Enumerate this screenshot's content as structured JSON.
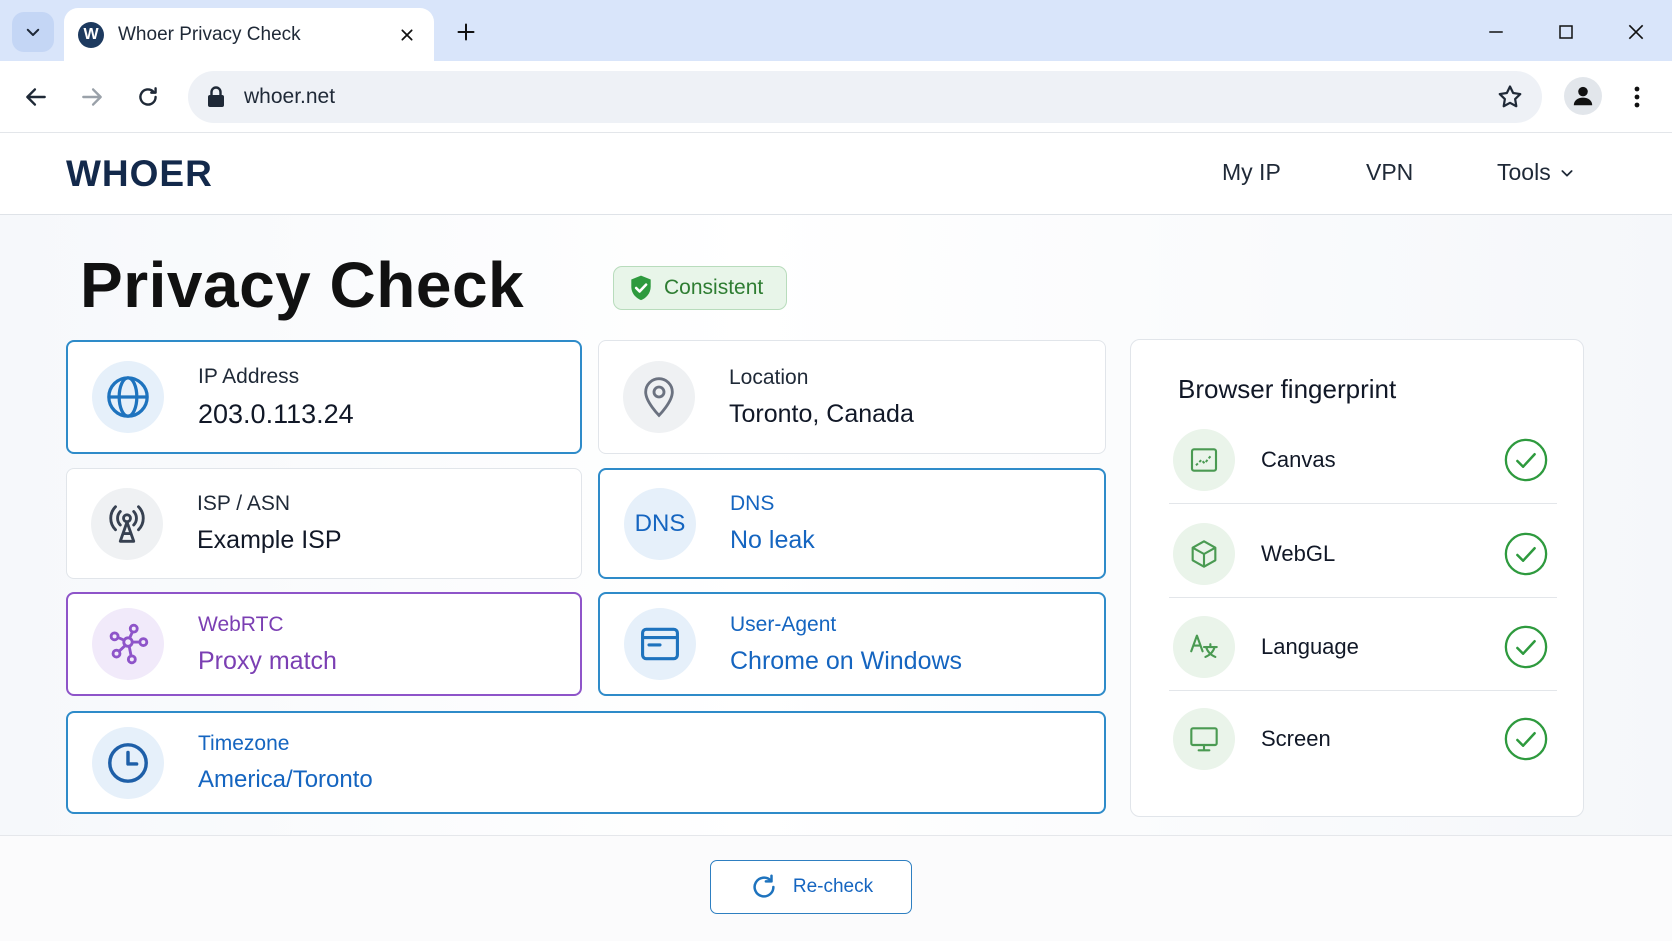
{
  "browser": {
    "tab_title": "Whoer Privacy Check",
    "favicon_letter": "W",
    "url": "whoer.net"
  },
  "site": {
    "logo": "WHOER",
    "nav": {
      "my_ip": "My IP",
      "vpn": "VPN",
      "tools": "Tools"
    }
  },
  "page": {
    "title": "Privacy Check",
    "badge": "Consistent"
  },
  "cards": {
    "ip": {
      "label": "IP Address",
      "value": "203.0.113.24"
    },
    "location": {
      "label": "Location",
      "value": "Toronto, Canada"
    },
    "isp": {
      "label": "ISP / ASN",
      "value": "Example ISP"
    },
    "dns": {
      "icon_text": "DNS",
      "label": "DNS",
      "value": "No leak"
    },
    "webrtc": {
      "label": "WebRTC",
      "value": "Proxy match"
    },
    "useragent": {
      "label": "User-Agent",
      "value": "Chrome on Windows"
    },
    "timezone": {
      "label": "Timezone",
      "value": "America/Toronto"
    }
  },
  "fingerprint": {
    "title": "Browser fingerprint",
    "items": [
      {
        "label": "Canvas",
        "icon": "canvas-icon",
        "status": "ok"
      },
      {
        "label": "WebGL",
        "icon": "cube-icon",
        "status": "ok"
      },
      {
        "label": "Language",
        "icon": "translate-icon",
        "status": "ok"
      },
      {
        "label": "Screen",
        "icon": "monitor-icon",
        "status": "ok"
      }
    ]
  },
  "actions": {
    "recheck": "Re-check"
  },
  "colors": {
    "accent_blue": "#1565c0",
    "accent_purple": "#7b3fb3",
    "ok_green": "#2e7d32",
    "logo_navy": "#13294b"
  }
}
